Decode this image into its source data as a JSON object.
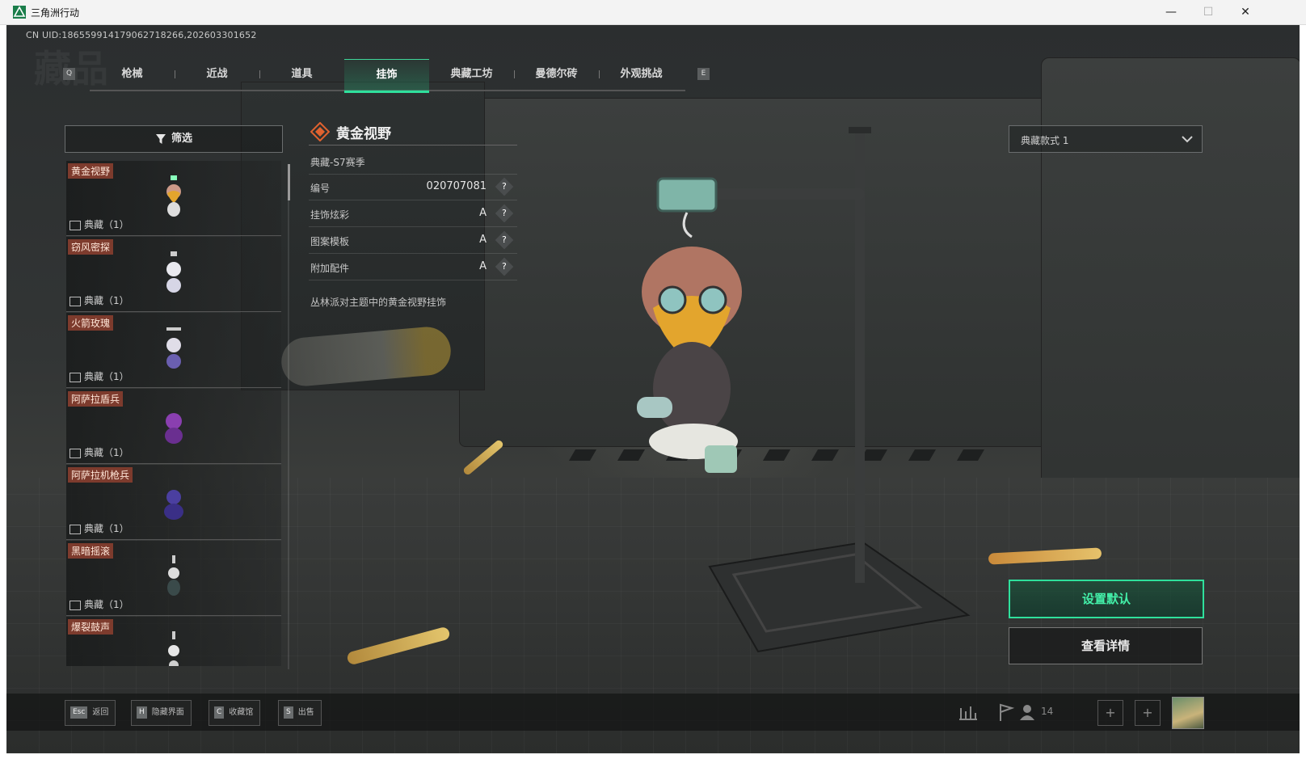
{
  "window": {
    "title": "三角洲行动",
    "minimize": "—",
    "maximize": "☐",
    "close": "✕"
  },
  "uid_text": "CN UID:1865599141790627182​66,202603301652",
  "watermark": "藏品",
  "tabs": {
    "left_key": "Q",
    "right_key": "E",
    "items": [
      {
        "label": "枪械"
      },
      {
        "label": "近战"
      },
      {
        "label": "道具"
      },
      {
        "label": "挂饰",
        "active": true
      },
      {
        "label": "典藏工坊"
      },
      {
        "label": "曼德尔砖"
      },
      {
        "label": "外观挑战"
      }
    ]
  },
  "filter": {
    "label": "筛选"
  },
  "list": {
    "items": [
      {
        "name": "黄金视野",
        "count": "典藏（1）"
      },
      {
        "name": "窃风密探",
        "count": "典藏（1）"
      },
      {
        "name": "火箭玫瑰",
        "count": "典藏（1）"
      },
      {
        "name": "阿萨拉盾兵",
        "count": "典藏（1）"
      },
      {
        "name": "阿萨拉机枪兵",
        "count": "典藏（1）"
      },
      {
        "name": "黑暗摇滚",
        "count": "典藏（1）"
      },
      {
        "name": "爆裂鼓声",
        "count": ""
      }
    ]
  },
  "detail": {
    "title": "黄金视野",
    "season": "典藏-S7赛季",
    "rows": [
      {
        "label": "编号",
        "value": "020707081"
      },
      {
        "label": "挂饰炫彩",
        "value": "A"
      },
      {
        "label": "图案模板",
        "value": "A"
      },
      {
        "label": "附加配件",
        "value": "A"
      }
    ],
    "help": "?",
    "description": "丛林派对主题中的黄金视野挂饰"
  },
  "style_select": {
    "value": "典藏款式 1"
  },
  "actions": {
    "set_default": "设置默认",
    "view_detail": "查看详情"
  },
  "bottom": {
    "hints": [
      {
        "key": "Esc",
        "label": "返回"
      },
      {
        "key": "H",
        "label": "隐藏界面"
      },
      {
        "key": "C",
        "label": "收藏馆"
      },
      {
        "key": "S",
        "label": "出售"
      }
    ],
    "friend_count": "14",
    "plus": "+"
  },
  "colors": {
    "accent": "#2fe09c",
    "name_tag": "#7d3b2d",
    "title_orange": "#e0622f"
  }
}
